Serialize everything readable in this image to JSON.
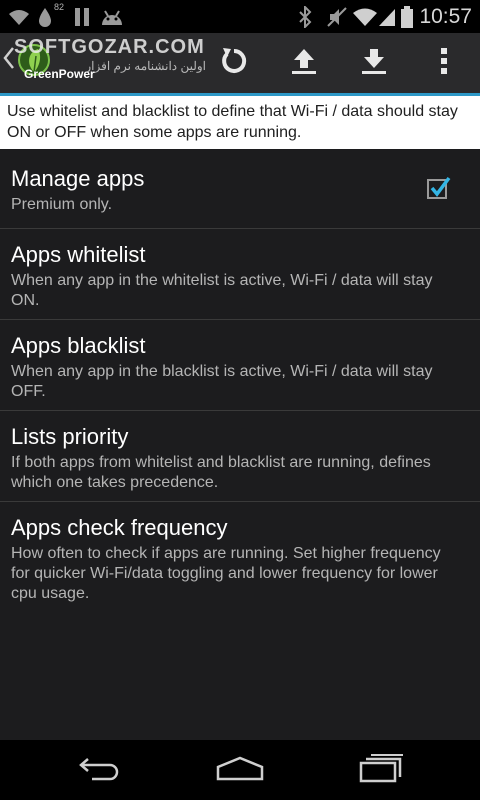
{
  "status_bar": {
    "battery_level": "82",
    "time": "10:57",
    "icons": [
      "wifi-signal-icon",
      "water-drop-icon",
      "pause-icon",
      "android-icon",
      "bluetooth-icon",
      "mute-icon",
      "wifi-icon",
      "cell-signal-icon",
      "battery-icon"
    ]
  },
  "action_bar": {
    "app_name": "GreenPower",
    "watermark_title": "SOFTGOZAR.COM",
    "watermark_subtitle": "اولین دانشنامه نرم افزار",
    "actions": [
      "refresh-icon",
      "upload-icon",
      "download-icon",
      "overflow-menu-icon"
    ]
  },
  "description": "Use whitelist and blacklist to define that Wi-Fi / data should stay ON or OFF when some apps are running.",
  "preferences": [
    {
      "title": "Manage apps",
      "summary": "Premium only.",
      "checked": true
    },
    {
      "title": "Apps whitelist",
      "summary": "When any app in the whitelist is active, Wi-Fi / data will stay ON."
    },
    {
      "title": "Apps blacklist",
      "summary": "When any app in the blacklist is active, Wi-Fi / data will stay OFF."
    },
    {
      "title": "Lists priority",
      "summary": "If both apps from whitelist and blacklist are running, defines which one takes precedence."
    },
    {
      "title": "Apps check frequency",
      "summary": "How often to check if apps are running. Set higher frequency for quicker Wi-Fi/data toggling and lower frequency for lower cpu usage."
    }
  ],
  "nav_bar": [
    "back-icon",
    "home-icon",
    "recent-apps-icon"
  ],
  "colors": {
    "accent": "#2d98c7",
    "background": "#1c1c1e",
    "checkmark": "#33b5e5"
  }
}
